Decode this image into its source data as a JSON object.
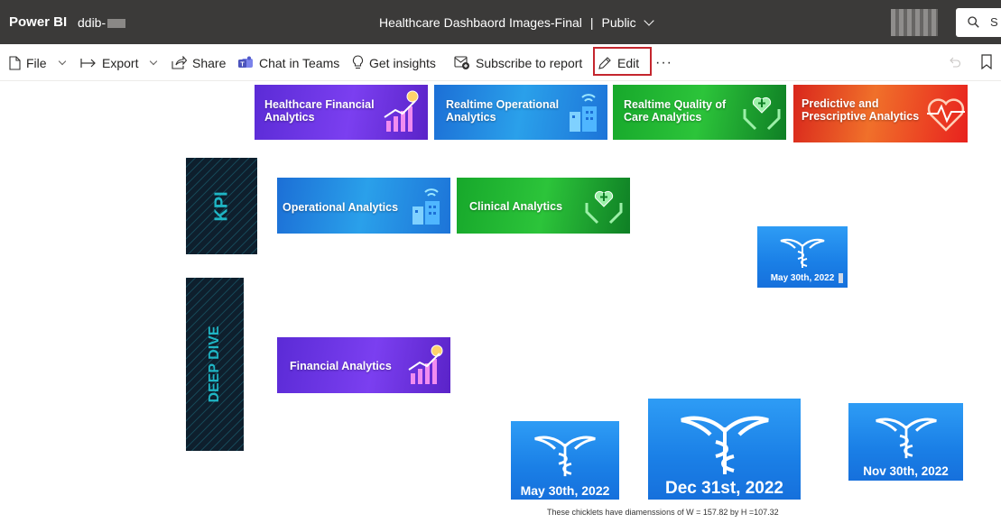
{
  "topbar": {
    "brand": "Power BI",
    "workspace": "ddib-",
    "report_title": "Healthcare Dashbaord Images-Final",
    "separator": "|",
    "visibility": "Public",
    "search_label": "S"
  },
  "toolbar": {
    "file": "File",
    "export": "Export",
    "share": "Share",
    "chat": "Chat in Teams",
    "insights": "Get insights",
    "subscribe": "Subscribe to report",
    "edit": "Edit",
    "more": "···"
  },
  "tiles": {
    "financial_top": "Healthcare Financial Analytics",
    "operational_top": "Realtime Operational Analytics",
    "quality_top": "Realtime Quality of Care Analytics",
    "predictive_top": "Predictive and Prescriptive Analytics",
    "kpi": "KPI",
    "operational": "Operational Analytics",
    "clinical": "Clinical Analytics",
    "deep_dive": "DEEP DIVE",
    "financial": "Financial Analytics"
  },
  "chicklets": {
    "small_top": "May 30th, 2022",
    "may": "May 30th, 2022",
    "dec": "Dec 31st, 2022",
    "nov": "Nov 30th, 2022"
  },
  "footnote": "These chicklets have diamenssions of W = 157.82 by H =107.32",
  "colors": {
    "topbar": "#3b3a39",
    "edit_highlight": "#c4262e",
    "chicklet_blue": "#1a7fe6",
    "deep_dive_teal": "#1fb5c4"
  },
  "icons": {
    "file": "file-icon",
    "export": "export-icon",
    "share": "share-icon",
    "teams": "teams-icon",
    "insights": "lightbulb-icon",
    "subscribe": "subscribe-icon",
    "edit": "pencil-icon",
    "search": "search-icon",
    "undo": "undo-icon",
    "bookmark": "bookmark-icon"
  }
}
